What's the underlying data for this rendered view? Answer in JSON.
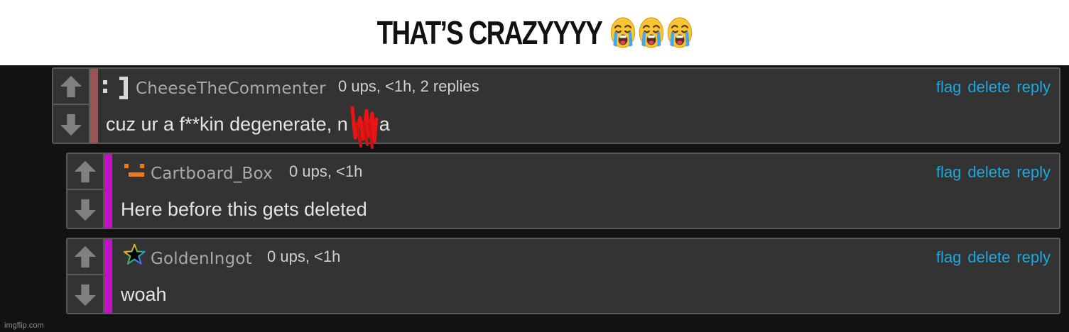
{
  "caption": {
    "text": "THAT’S CRAZYYYY",
    "emojis": [
      "loudly-crying-face",
      "loudly-crying-face",
      "loudly-crying-face"
    ]
  },
  "colors": {
    "caption_background": "#ffffff",
    "page_background": "#121212",
    "comment_background": "#333333",
    "link": "#1ea8e0",
    "thread_bar_root": "#9b5454",
    "thread_bar_reply": "#c40fc9",
    "redaction_scribble": "#e81515"
  },
  "comments": [
    {
      "username": "CheeseTheCommenter",
      "meta": "0 ups, <1h, 2 replies",
      "body_before": "cuz ur a f**kin degenerate, n",
      "body_after": "a",
      "avatar_icon": "bracket-face-icon",
      "actions": {
        "flag": "flag",
        "delete": "delete",
        "reply": "reply"
      }
    },
    {
      "username": "Cartboard_Box",
      "meta": "0 ups, <1h",
      "body": "Here before this gets deleted",
      "avatar_icon": "orange-box-face-icon",
      "actions": {
        "flag": "flag",
        "delete": "delete",
        "reply": "reply"
      }
    },
    {
      "username": "GoldenIngot",
      "meta": "0 ups, <1h",
      "body": "woah",
      "avatar_icon": "rainbow-star-icon",
      "actions": {
        "flag": "flag",
        "delete": "delete",
        "reply": "reply"
      }
    }
  ],
  "watermark": "imgflip.com"
}
